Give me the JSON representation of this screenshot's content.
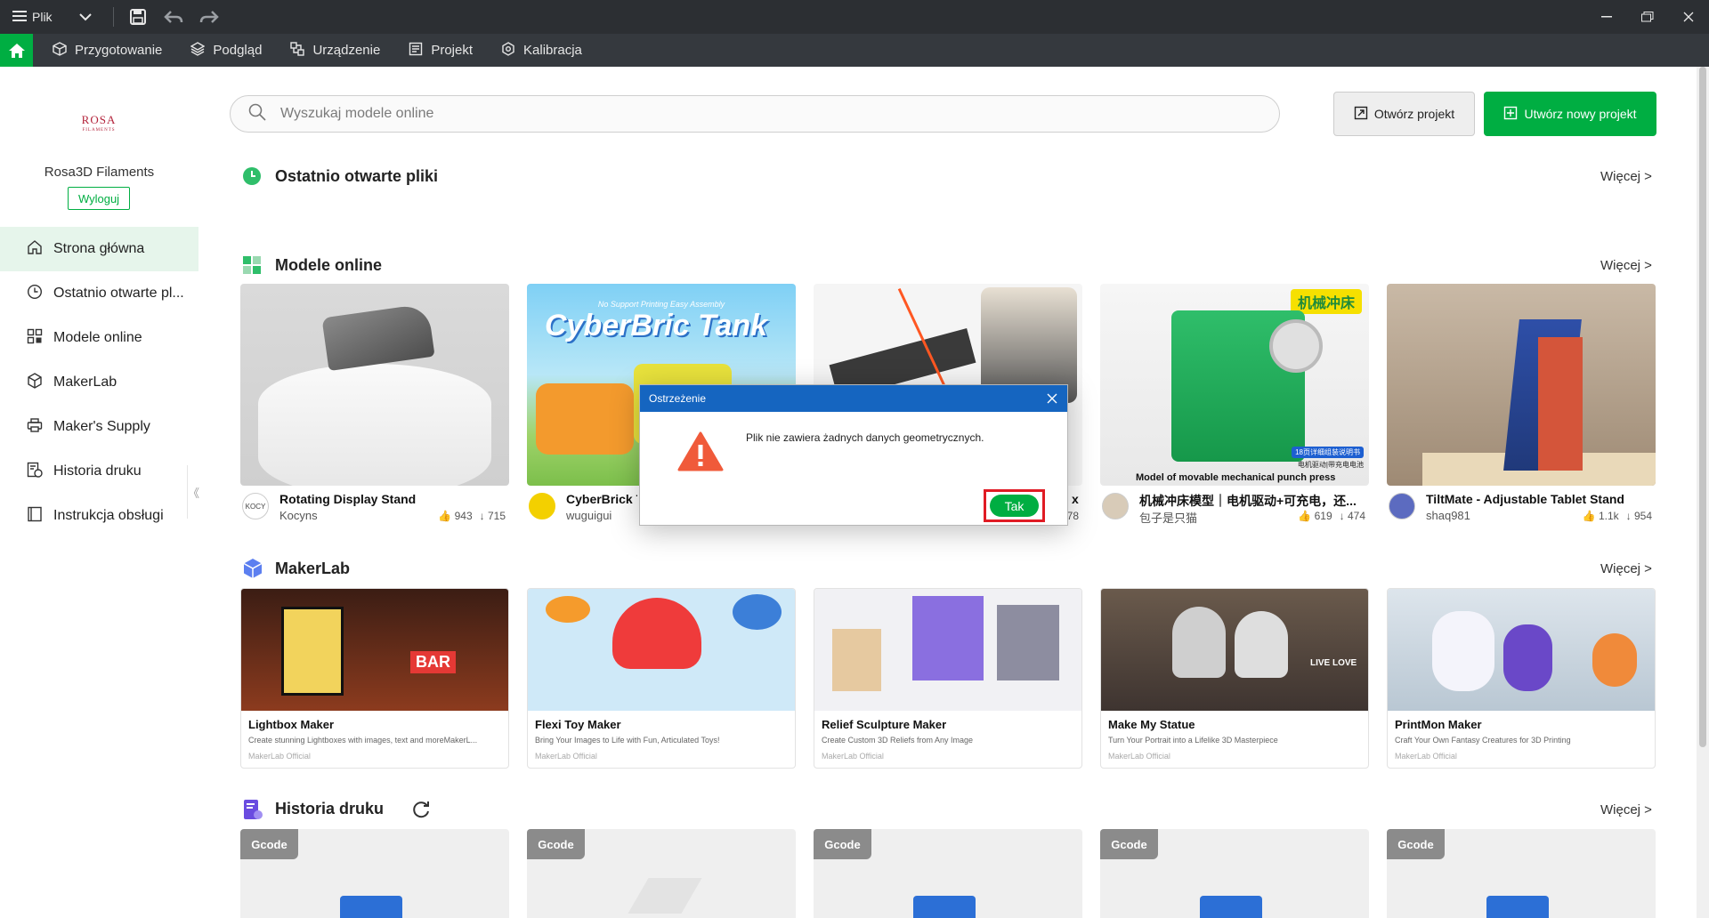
{
  "titlebar": {
    "menu_label": "Plik"
  },
  "tabs": [
    {
      "label": "Przygotowanie"
    },
    {
      "label": "Podgląd"
    },
    {
      "label": "Urządzenie"
    },
    {
      "label": "Projekt"
    },
    {
      "label": "Kalibracja"
    }
  ],
  "sidebar": {
    "logo_text": "ROSA",
    "logo_sub": "FILAMENTS",
    "user_name": "Rosa3D Filaments",
    "logout_label": "Wyloguj",
    "items": [
      {
        "label": "Strona główna"
      },
      {
        "label": "Ostatnio otwarte pl..."
      },
      {
        "label": "Modele online"
      },
      {
        "label": "MakerLab"
      },
      {
        "label": "Maker's Supply"
      },
      {
        "label": "Historia druku"
      },
      {
        "label": "Instrukcja obsługi"
      }
    ],
    "collapse_glyph": "《"
  },
  "search": {
    "placeholder": "Wyszukaj modele online"
  },
  "actions": {
    "open_project": "Otwórz projekt",
    "new_project": "Utwórz nowy projekt"
  },
  "sections": {
    "recent": {
      "title": "Ostatnio otwarte pliki",
      "more": "Więcej >"
    },
    "online": {
      "title": "Modele online",
      "more": "Więcej >"
    },
    "makerlab": {
      "title": "MakerLab",
      "more": "Więcej >"
    },
    "history": {
      "title": "Historia druku",
      "more": "Więcej >"
    }
  },
  "online_models": [
    {
      "title": "Rotating Display Stand",
      "author": "Kocyns",
      "avatar": "KOCY",
      "likes": "943",
      "downloads": "715"
    },
    {
      "title": "CyberBrick T",
      "author": "wuguigui",
      "avatar": "",
      "likes": "",
      "downloads": "",
      "image_text": "CyberBric  Tank",
      "image_sub": "No Support Printing  Easy Assembly"
    },
    {
      "title": "x",
      "author": "",
      "avatar": "",
      "likes": "",
      "downloads": "78"
    },
    {
      "title": "机械冲床模型｜电机驱动+可充电，还...",
      "author": "包子是只猫",
      "avatar": "",
      "likes": "619",
      "downloads": "474",
      "image_badge": "机械冲床",
      "image_caption": "Model of movable mechanical punch press",
      "image_note": "18页详细组装说明书",
      "image_note2": "电机驱动|带充电电池"
    },
    {
      "title": "TiltMate - Adjustable Tablet Stand",
      "author": "shaq981",
      "avatar": "",
      "likes": "1.1k",
      "downloads": "954"
    }
  ],
  "makerlab": [
    {
      "title": "Lightbox Maker",
      "desc": "Create stunning Lightboxes with images, text and moreMakerL...",
      "author": "MakerLab Official",
      "image_text": "BAR"
    },
    {
      "title": "Flexi Toy Maker",
      "desc": "Bring Your Images to Life with Fun, Articulated Toys!",
      "author": "MakerLab Official"
    },
    {
      "title": "Relief Sculpture Maker",
      "desc": "Create Custom 3D Reliefs from Any Image",
      "author": "MakerLab Official"
    },
    {
      "title": "Make My Statue",
      "desc": "Turn Your Portrait into a Lifelike 3D Masterpiece",
      "author": "MakerLab Official",
      "image_text": "LIVE LOVE"
    },
    {
      "title": "PrintMon Maker",
      "desc": "Craft Your Own Fantasy Creatures for 3D Printing",
      "author": "MakerLab Official"
    }
  ],
  "history": [
    {
      "badge": "Gcode"
    },
    {
      "badge": "Gcode"
    },
    {
      "badge": "Gcode"
    },
    {
      "badge": "Gcode"
    },
    {
      "badge": "Gcode"
    }
  ],
  "dialog": {
    "title": "Ostrzeżenie",
    "message": "Plik nie zawiera żadnych danych geometrycznych.",
    "ok_label": "Tak"
  },
  "colors": {
    "accent": "#00ae42",
    "dialog_header": "#1565c0",
    "highlight": "#e01b24",
    "titlebar": "#2c2f33",
    "tabbar": "#35393e"
  }
}
